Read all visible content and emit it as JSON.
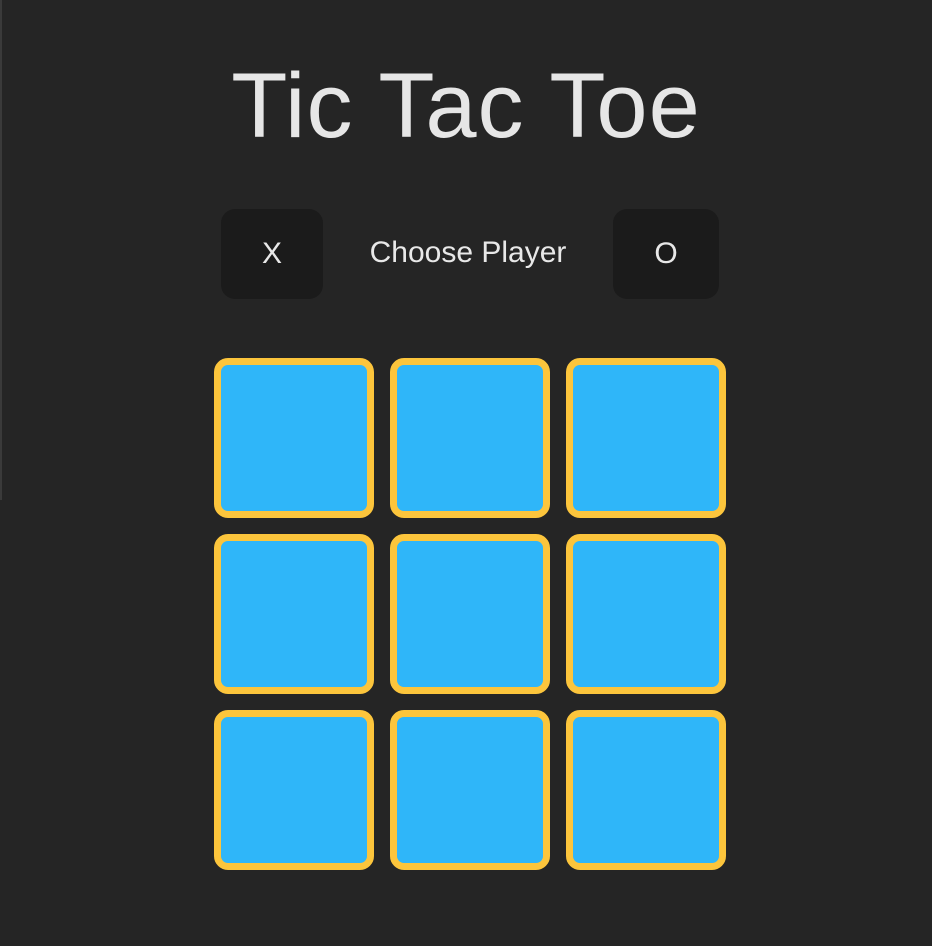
{
  "title": "Tic Tac Toe",
  "controls": {
    "player_x": "X",
    "choose_label": "Choose Player",
    "player_o": "O"
  },
  "board": {
    "cells": [
      "",
      "",
      "",
      "",
      "",
      "",
      "",
      "",
      ""
    ]
  },
  "colors": {
    "background": "#252525",
    "cell_fill": "#2fb6f9",
    "cell_border": "#fcc53c",
    "button_bg": "#1b1b1b",
    "text": "#e6e6e6"
  }
}
